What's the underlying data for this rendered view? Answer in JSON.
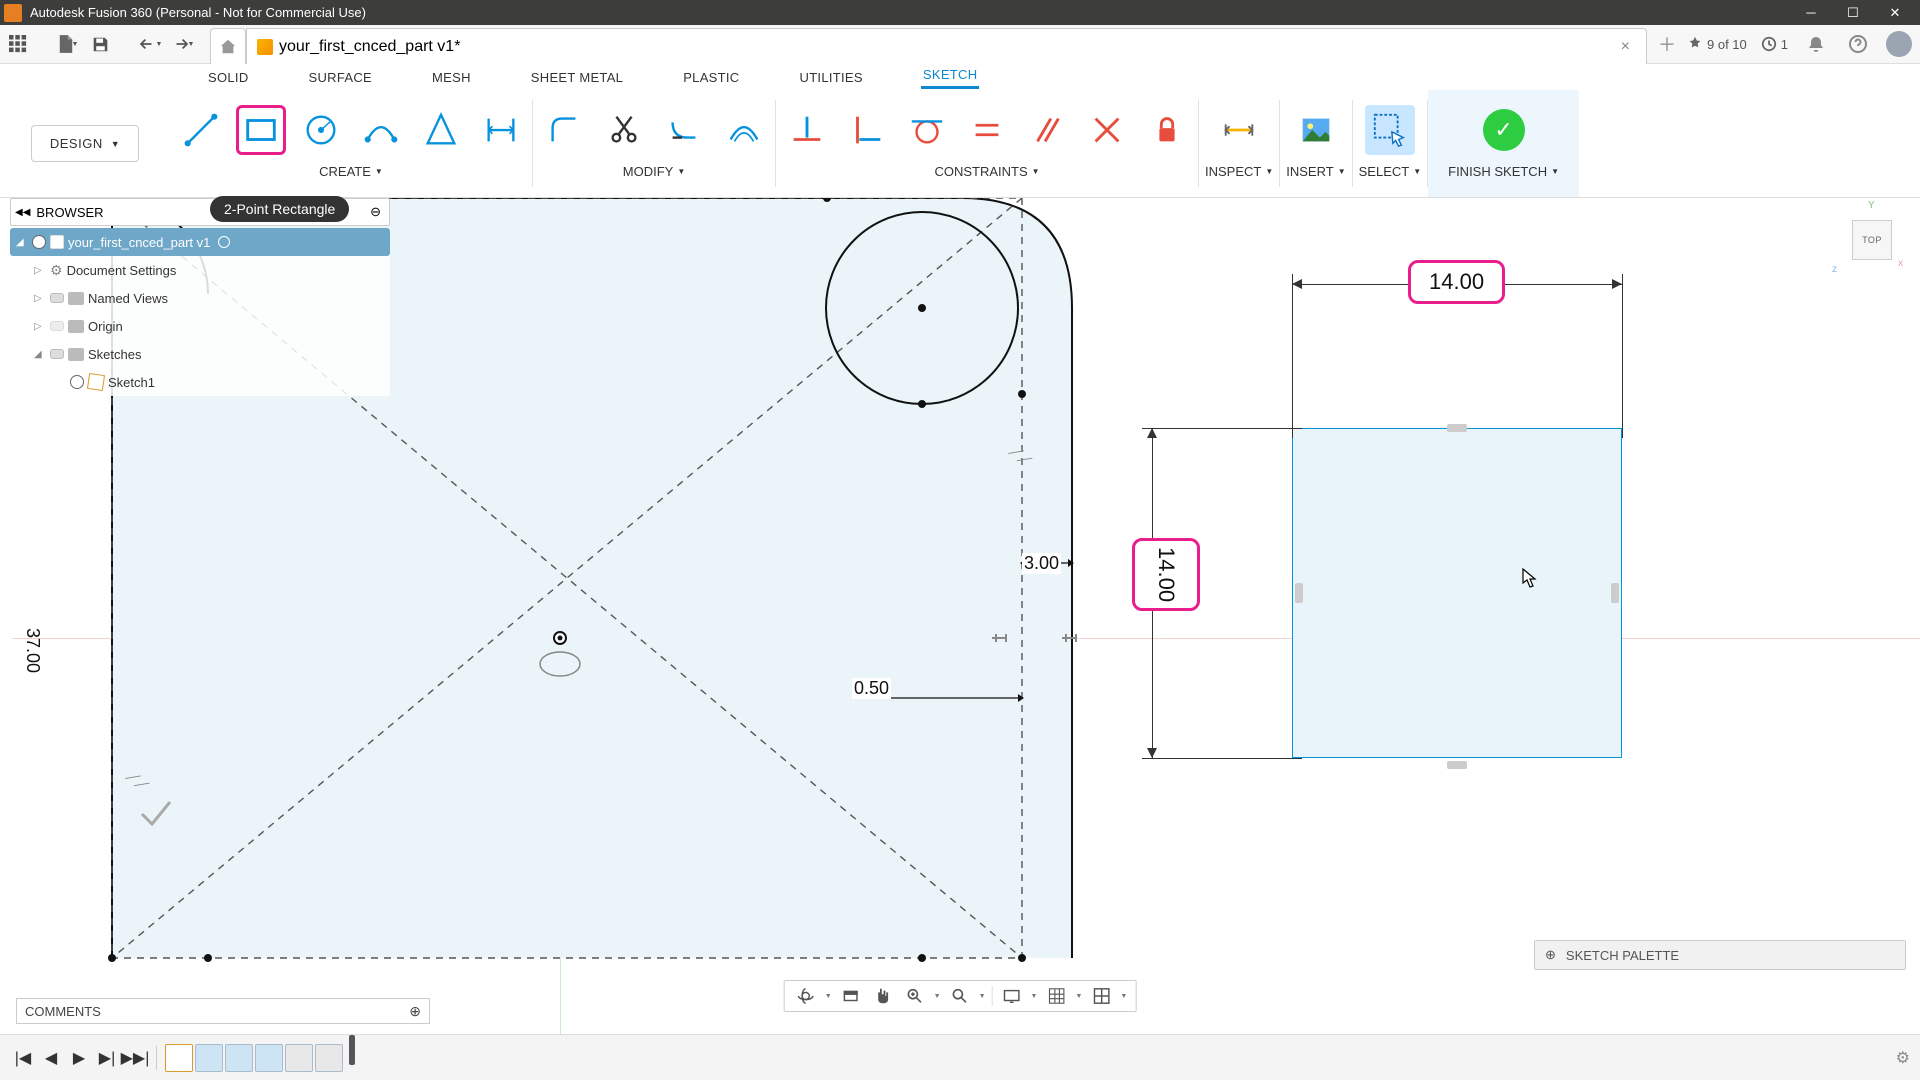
{
  "titlebar": {
    "title": "Autodesk Fusion 360 (Personal - Not for Commercial Use)"
  },
  "qat": {
    "doc_title": "your_first_cnced_part v1*",
    "recovery": "9 of 10",
    "job_count": "1"
  },
  "ribbon_tabs": [
    "SOLID",
    "SURFACE",
    "MESH",
    "SHEET METAL",
    "PLASTIC",
    "UTILITIES",
    "SKETCH"
  ],
  "active_ribbon_tab": "SKETCH",
  "workspace_label": "DESIGN",
  "ribbon_groups": {
    "create": "CREATE",
    "modify": "MODIFY",
    "constraints": "CONSTRAINTS",
    "inspect": "INSPECT",
    "insert": "INSERT",
    "select": "SELECT",
    "finish": "FINISH SKETCH"
  },
  "tooltip": "2-Point Rectangle",
  "browser": {
    "title": "BROWSER",
    "root": "your_first_cnced_part v1",
    "items": [
      "Document Settings",
      "Named Views",
      "Origin",
      "Sketches"
    ],
    "sketch_child": "Sketch1"
  },
  "dimensions": {
    "side_long": "37.00",
    "inset": "3.00",
    "fillet": "0.50",
    "rect_w": "14.00",
    "rect_h": "14.00"
  },
  "viewcube": {
    "face": "TOP"
  },
  "sketch_palette": "SKETCH PALETTE",
  "comments": "COMMENTS"
}
